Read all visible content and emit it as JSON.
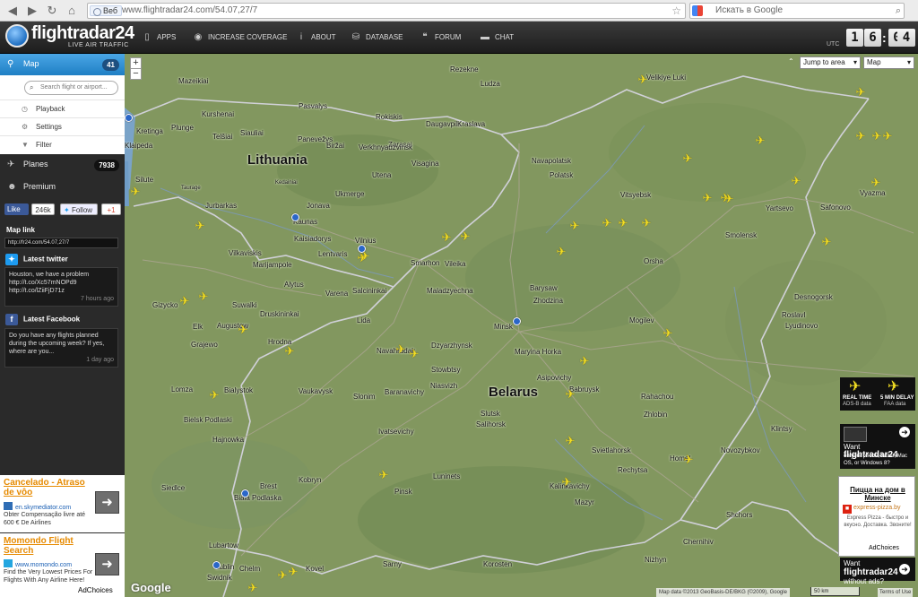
{
  "browser": {
    "tab_label": "Веб",
    "url": "www.flightradar24.com/54.07,27/7",
    "search_placeholder": "Искать в Google"
  },
  "header": {
    "logo_text": "flightradar24",
    "logo_sub": "LIVE AIR TRAFFIC",
    "nav": [
      {
        "label": "APPS",
        "icon": "phone-icon"
      },
      {
        "label": "INCREASE COVERAGE",
        "icon": "eye-icon"
      },
      {
        "label": "ABOUT",
        "icon": "info-icon"
      },
      {
        "label": "DATABASE",
        "icon": "database-icon"
      },
      {
        "label": "FORUM",
        "icon": "quote-icon"
      },
      {
        "label": "CHAT",
        "icon": "chat-icon"
      }
    ],
    "clock": {
      "utc_label": "UTC",
      "h1": "1",
      "h2": "6",
      "m1": "0",
      "m2": "4"
    }
  },
  "sidebar": {
    "map": {
      "label": "Map",
      "count": "41"
    },
    "search_placeholder": "Search flight or airport...",
    "map_items": [
      {
        "label": "Playback",
        "icon": "clock-icon"
      },
      {
        "label": "Settings",
        "icon": "gear-icon"
      },
      {
        "label": "Filter",
        "icon": "filter-icon"
      }
    ],
    "planes": {
      "label": "Planes",
      "count": "7938"
    },
    "premium": {
      "label": "Premium"
    },
    "social": {
      "like": "Like",
      "like_count": "246k",
      "follow": "Follow",
      "gplus": "+1"
    },
    "map_link": {
      "label": "Map link",
      "value": "http://fr24.com/54.07,27/7"
    },
    "twitter": {
      "heading": "Latest twitter",
      "text": "Houston, we have a problem http://t.co/Xc57mNOPd9 http://t.co/lZiiFjD71z",
      "time": "7 hours ago"
    },
    "facebook": {
      "heading": "Latest Facebook",
      "text": "Do you have any flights planned during the upcoming week? If yes, where are you...",
      "time": "1 day ago"
    },
    "ads": [
      {
        "title": "Cancelado - Atraso de vôo",
        "domain": "en.skymediator.com",
        "desc": "Obter Compensação livre até 600 € De Airlines"
      },
      {
        "title": "Momondo Flight Search",
        "domain": "www.momondo.com",
        "desc": "Find the Very Lowest Prices For Flights With Any Airline Here!"
      }
    ],
    "adchoices": "AdChoices"
  },
  "map": {
    "jump_label": "Jump to area",
    "type_label": "Map",
    "countries": [
      {
        "name": "Lithuania"
      },
      {
        "name": "Belarus"
      }
    ],
    "cities": [
      "Mazeikiai",
      "Rezekne",
      "Ludza",
      "Kurshenai",
      "Siauliai",
      "Rokiskis",
      "Daugavpils",
      "Kraslava",
      "Velikiye Luki",
      "Pasvalys",
      "Kretinga",
      "Plunge",
      "Telšiai",
      "Panevežys",
      "Zarasai",
      "Biržai",
      "Verkhnyadzvinsk",
      "Klaipeda",
      "Silute",
      "Taurage",
      "Kedainiai",
      "Ukmerge",
      "Utena",
      "Visagina",
      "Navapolatsk",
      "Polatsk",
      "Jurbarkas",
      "Jonava",
      "Vitsyebsk",
      "Yartsevo",
      "Safonovo",
      "Vyazma",
      "Smolensk",
      "Kaunas",
      "Kaisiadorys",
      "Vilnius",
      "Lentvaris",
      "Vilkaviskis",
      "Marijampole",
      "Alytus",
      "Varena",
      "Salcininkai",
      "Smarhon",
      "Vileika",
      "Maladzyechna",
      "Barysaw",
      "Orsha",
      "Zhodzina",
      "Gizycko",
      "Suwalki",
      "Druskininkai",
      "Augustow",
      "Elk",
      "Grajewo",
      "Hrodna",
      "Lida",
      "Mogilev",
      "Roslavl",
      "Desnogorsk",
      "Lyudinovo",
      "Minsk",
      "Maryina Horka",
      "Navahrudak",
      "Dzyarzhynsk",
      "Stowbtsy",
      "Asipovichy",
      "Babruysk",
      "Lomza",
      "Bialystok",
      "Vaukavysk",
      "Slonim",
      "Baranavichy",
      "Niasvizh",
      "Rahachou",
      "Zhlobin",
      "Klintsy",
      "Bielsk Podlaski",
      "Hajnowka",
      "Ivatsevichy",
      "Slutsk",
      "Salihorsk",
      "Svietlahorsk",
      "Novozybkov",
      "Homel",
      "Rechytsa",
      "Kobryn",
      "Pinsk",
      "Luninets",
      "Mazyr",
      "Kalinkavichy",
      "Siedlce",
      "Brest",
      "Biala Podlaska",
      "Shchors",
      "Chernihiv",
      "Lubartow",
      "Kovel",
      "Lublin",
      "Swidnik",
      "Chelm",
      "Sarny",
      "Korosten",
      "Nizhyn"
    ],
    "plane_count": "41",
    "google_logo": "Google",
    "copyright": "Map data ©2013 GeoBasis-DE/BKG (©2009), Google",
    "scale": "50 km",
    "terms": "Terms of Use"
  },
  "right_ads": {
    "realtime": {
      "title1": "REAL TIME",
      "sub1": "ADS-B data",
      "title2": "5 MIN DELAY",
      "sub2": "FAA data"
    },
    "want_app": {
      "pre": "Want",
      "brand": "flightradar24",
      "line": "on your phone, tablet, Mac OS, or Windows 8?"
    },
    "pizza": {
      "title": "Пицца на дом в Минске",
      "domain": "express-pizza.by",
      "desc": "Express Pizza - быстро и вкусно. Доставка. Звоните!"
    },
    "adchoices": "AdChoices",
    "want_noads": {
      "pre": "Want",
      "brand": "flightradar24",
      "line": "without ads?"
    }
  }
}
